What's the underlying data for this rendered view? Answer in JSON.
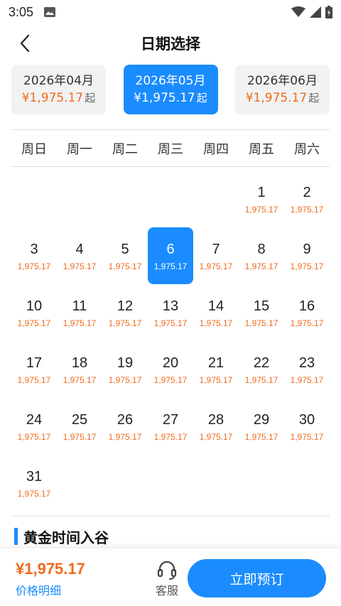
{
  "status_bar": {
    "time": "3:05"
  },
  "header": {
    "title": "日期选择"
  },
  "months": [
    {
      "label": "2026年04月",
      "price": "¥1,975.17",
      "suffix": "起",
      "active": false
    },
    {
      "label": "2026年05月",
      "price": "¥1,975.17",
      "suffix": "起",
      "active": true
    },
    {
      "label": "2026年06月",
      "price": "¥1,975.17",
      "suffix": "起",
      "active": false
    }
  ],
  "weekdays": [
    "周日",
    "周一",
    "周二",
    "周三",
    "周四",
    "周五",
    "周六"
  ],
  "calendar": {
    "leading_blanks": 5,
    "selected_day": 6,
    "days": [
      {
        "day": "1",
        "price": "1,975.17"
      },
      {
        "day": "2",
        "price": "1,975.17"
      },
      {
        "day": "3",
        "price": "1,975.17"
      },
      {
        "day": "4",
        "price": "1,975.17"
      },
      {
        "day": "5",
        "price": "1,975.17"
      },
      {
        "day": "6",
        "price": "1,975.17"
      },
      {
        "day": "7",
        "price": "1,975.17"
      },
      {
        "day": "8",
        "price": "1,975.17"
      },
      {
        "day": "9",
        "price": "1,975.17"
      },
      {
        "day": "10",
        "price": "1,975.17"
      },
      {
        "day": "11",
        "price": "1,975.17"
      },
      {
        "day": "12",
        "price": "1,975.17"
      },
      {
        "day": "13",
        "price": "1,975.17"
      },
      {
        "day": "14",
        "price": "1,975.17"
      },
      {
        "day": "15",
        "price": "1,975.17"
      },
      {
        "day": "16",
        "price": "1,975.17"
      },
      {
        "day": "17",
        "price": "1,975.17"
      },
      {
        "day": "18",
        "price": "1,975.17"
      },
      {
        "day": "19",
        "price": "1,975.17"
      },
      {
        "day": "20",
        "price": "1,975.17"
      },
      {
        "day": "21",
        "price": "1,975.17"
      },
      {
        "day": "22",
        "price": "1,975.17"
      },
      {
        "day": "23",
        "price": "1,975.17"
      },
      {
        "day": "24",
        "price": "1,975.17"
      },
      {
        "day": "25",
        "price": "1,975.17"
      },
      {
        "day": "26",
        "price": "1,975.17"
      },
      {
        "day": "27",
        "price": "1,975.17"
      },
      {
        "day": "28",
        "price": "1,975.17"
      },
      {
        "day": "29",
        "price": "1,975.17"
      },
      {
        "day": "30",
        "price": "1,975.17"
      },
      {
        "day": "31",
        "price": "1,975.17"
      }
    ]
  },
  "section": {
    "title": "黄金时间入谷"
  },
  "footer": {
    "total": "¥1,975.17",
    "detail_label": "价格明细",
    "service_label": "客服",
    "book_label": "立即预订"
  },
  "colors": {
    "accent": "#1a8cff",
    "price": "#f06a1e"
  },
  "icons": [
    "image-icon",
    "wifi-icon",
    "signal-icon",
    "battery-icon",
    "back-arrow-icon",
    "headset-icon"
  ]
}
